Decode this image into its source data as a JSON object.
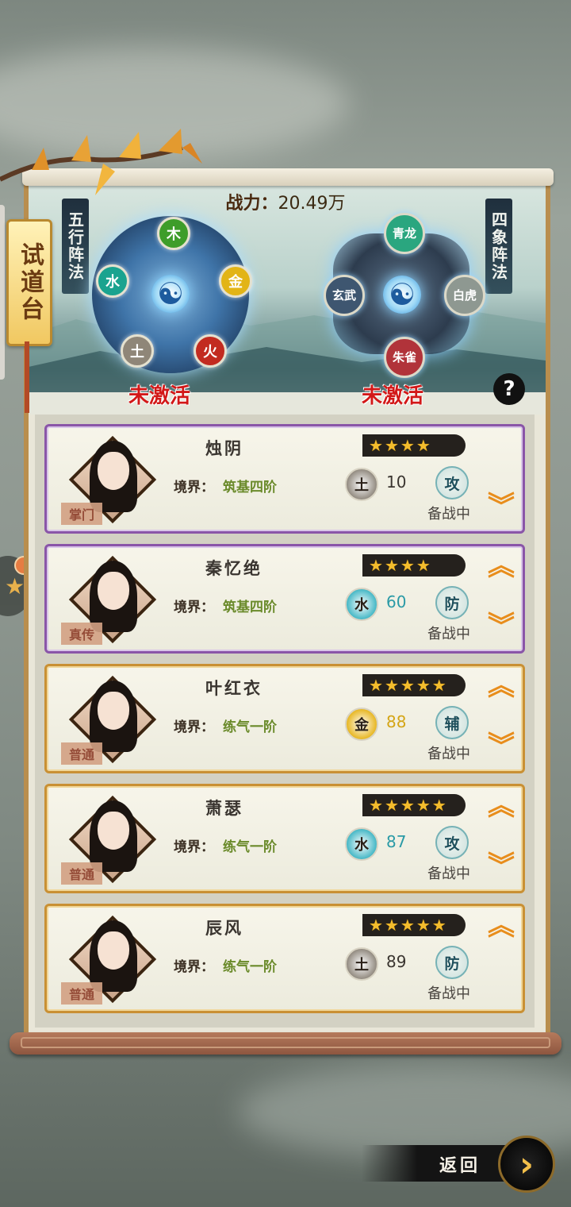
{
  "page": {
    "side_tab": "试道台",
    "power_label": "战力：",
    "power_value": "20.49万",
    "back_label": "返回"
  },
  "formations": {
    "left": {
      "title": "五行阵法",
      "status": "未激活",
      "nodes": [
        "木",
        "金",
        "火",
        "土",
        "水"
      ]
    },
    "right": {
      "title": "四象阵法",
      "status": "未激活",
      "beasts": [
        "青龙",
        "白虎",
        "朱雀",
        "玄武"
      ]
    }
  },
  "realm_label": "境界：",
  "colors": {
    "accent_gold": "#c99034",
    "accent_purple": "#8a55a8",
    "inactive_red": "#d21818",
    "realm_green": "#6a8a2a",
    "arrow_orange": "#e88d1c"
  },
  "disciples": [
    {
      "name": "烛阴",
      "rank": "掌门",
      "stars": 4,
      "realm": "筑基四阶",
      "element": "土",
      "element_color": "#8b8378",
      "value": "10",
      "value_color": "#3a3530",
      "role": "攻",
      "status": "备战中",
      "frame": "purple",
      "up_arrow": false,
      "down_arrow": true
    },
    {
      "name": "秦忆绝",
      "rank": "真传",
      "stars": 4,
      "realm": "筑基四阶",
      "element": "水",
      "element_color": "#39b3c2",
      "value": "60",
      "value_color": "#2a9aa6",
      "role": "防",
      "status": "备战中",
      "frame": "purple",
      "up_arrow": true,
      "down_arrow": true
    },
    {
      "name": "叶红衣",
      "rank": "普通",
      "stars": 5,
      "realm": "练气一阶",
      "element": "金",
      "element_color": "#e6b214",
      "value": "88",
      "value_color": "#d4a516",
      "role": "辅",
      "status": "备战中",
      "frame": "gold",
      "up_arrow": true,
      "down_arrow": true
    },
    {
      "name": "萧瑟",
      "rank": "普通",
      "stars": 5,
      "realm": "练气一阶",
      "element": "水",
      "element_color": "#39b3c2",
      "value": "87",
      "value_color": "#2a9aa6",
      "role": "攻",
      "status": "备战中",
      "frame": "gold",
      "up_arrow": true,
      "down_arrow": true
    },
    {
      "name": "辰风",
      "rank": "普通",
      "stars": 5,
      "realm": "练气一阶",
      "element": "土",
      "element_color": "#8b8378",
      "value": "89",
      "value_color": "#3a3530",
      "role": "防",
      "status": "备战中",
      "frame": "gold",
      "up_arrow": true,
      "down_arrow": false
    }
  ]
}
